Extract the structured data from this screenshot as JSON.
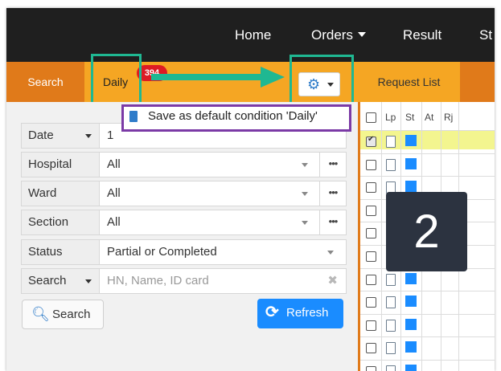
{
  "nav": {
    "items": [
      {
        "label": "Home",
        "caret": false
      },
      {
        "label": "Orders",
        "caret": true
      },
      {
        "label": "Result",
        "caret": false
      },
      {
        "label": "St",
        "caret": false
      }
    ]
  },
  "tabs": {
    "search": "Search",
    "daily": "Daily",
    "daily_badge": "394",
    "request_list": "Request List"
  },
  "settings_menu": {
    "item": "Save as default condition 'Daily'"
  },
  "form": {
    "date": {
      "label": "Date",
      "value": "1"
    },
    "hospital": {
      "label": "Hospital",
      "value": "All"
    },
    "ward": {
      "label": "Ward",
      "value": "All"
    },
    "section": {
      "label": "Section",
      "value": "All"
    },
    "status": {
      "label": "Status",
      "value": "Partial or Completed"
    },
    "search": {
      "label": "Search",
      "placeholder": "HN, Name, ID card"
    },
    "search_button": "Search",
    "refresh_button": "Refresh"
  },
  "request_grid": {
    "columns": [
      "Lp",
      "St",
      "At",
      "Rj"
    ],
    "selected_row": 1
  },
  "step_overlay": "2",
  "colors": {
    "nav_bg": "#1f1f1f",
    "tab_orange": "#e07a1a",
    "tab_active": "#f5a623",
    "primary_blue": "#1a8cff",
    "annotation_green": "#1fb892",
    "annotation_purple": "#7b3aa6",
    "badge_red": "#dd1b24"
  }
}
